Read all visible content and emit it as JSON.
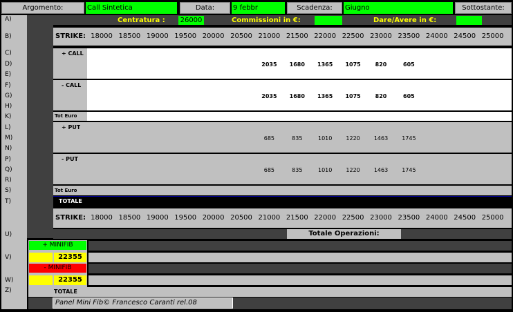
{
  "header": {
    "argomento_label": "Argomento:",
    "argomento_value": "Call Sintetica",
    "data_label": "Data:",
    "data_value": "9 febbr",
    "scadenza_label": "Scadenza:",
    "scadenza_value": "Giugno",
    "sottostante_label": "Sottostante:"
  },
  "summary": {
    "centratura_label": "Centratura :",
    "centratura_value": "26000",
    "commissioni_label": "Commissioni in €:",
    "dare_avere_label": "Dare/Avere in €:"
  },
  "row_labels": [
    "A)",
    "B)",
    "C)",
    "D)",
    "E)",
    "F)",
    "G)",
    "H)",
    "K)",
    "L)",
    "M)",
    "N)",
    "P)",
    "Q)",
    "R)",
    "S)",
    "T)",
    "U)",
    "V)",
    "W)",
    "Z)"
  ],
  "strike_label": "STRIKE:",
  "strikes": [
    "18000",
    "18500",
    "19000",
    "19500",
    "20000",
    "20500",
    "21000",
    "21500",
    "22000",
    "22500",
    "23000",
    "23500",
    "24000",
    "24500",
    "25000"
  ],
  "call_plus": {
    "label": "+ CALL",
    "values": [
      "",
      "",
      "",
      "",
      "",
      "",
      "2035",
      "1680",
      "1365",
      "1075",
      "820",
      "605",
      "",
      "",
      ""
    ]
  },
  "call_minus": {
    "label": "- CALL",
    "values": [
      "",
      "",
      "",
      "",
      "",
      "",
      "2035",
      "1680",
      "1365",
      "1075",
      "820",
      "605",
      "",
      "",
      ""
    ]
  },
  "tot_euro_1": "Tot Euro",
  "put_plus": {
    "label": "+ PUT",
    "values": [
      "",
      "",
      "",
      "",
      "",
      "",
      "685",
      "835",
      "1010",
      "1220",
      "1463",
      "1745",
      "",
      "",
      ""
    ]
  },
  "put_minus": {
    "label": "- PUT",
    "values": [
      "",
      "",
      "",
      "",
      "",
      "",
      "685",
      "835",
      "1010",
      "1220",
      "1463",
      "1745",
      "",
      "",
      ""
    ]
  },
  "tot_euro_2": "Tot Euro",
  "totale_label": "TOTALE",
  "totale_operazioni_label": "Totale Operazioni:",
  "minifib_plus": {
    "label": "+ MINIFIB",
    "value": "22355"
  },
  "minifib_minus": {
    "label": "- MINIFIB",
    "value": "22355"
  },
  "totale_bottom": "TOTALE",
  "footer": "Panel Mini Fib©  Francesco Caranti  rel.08"
}
